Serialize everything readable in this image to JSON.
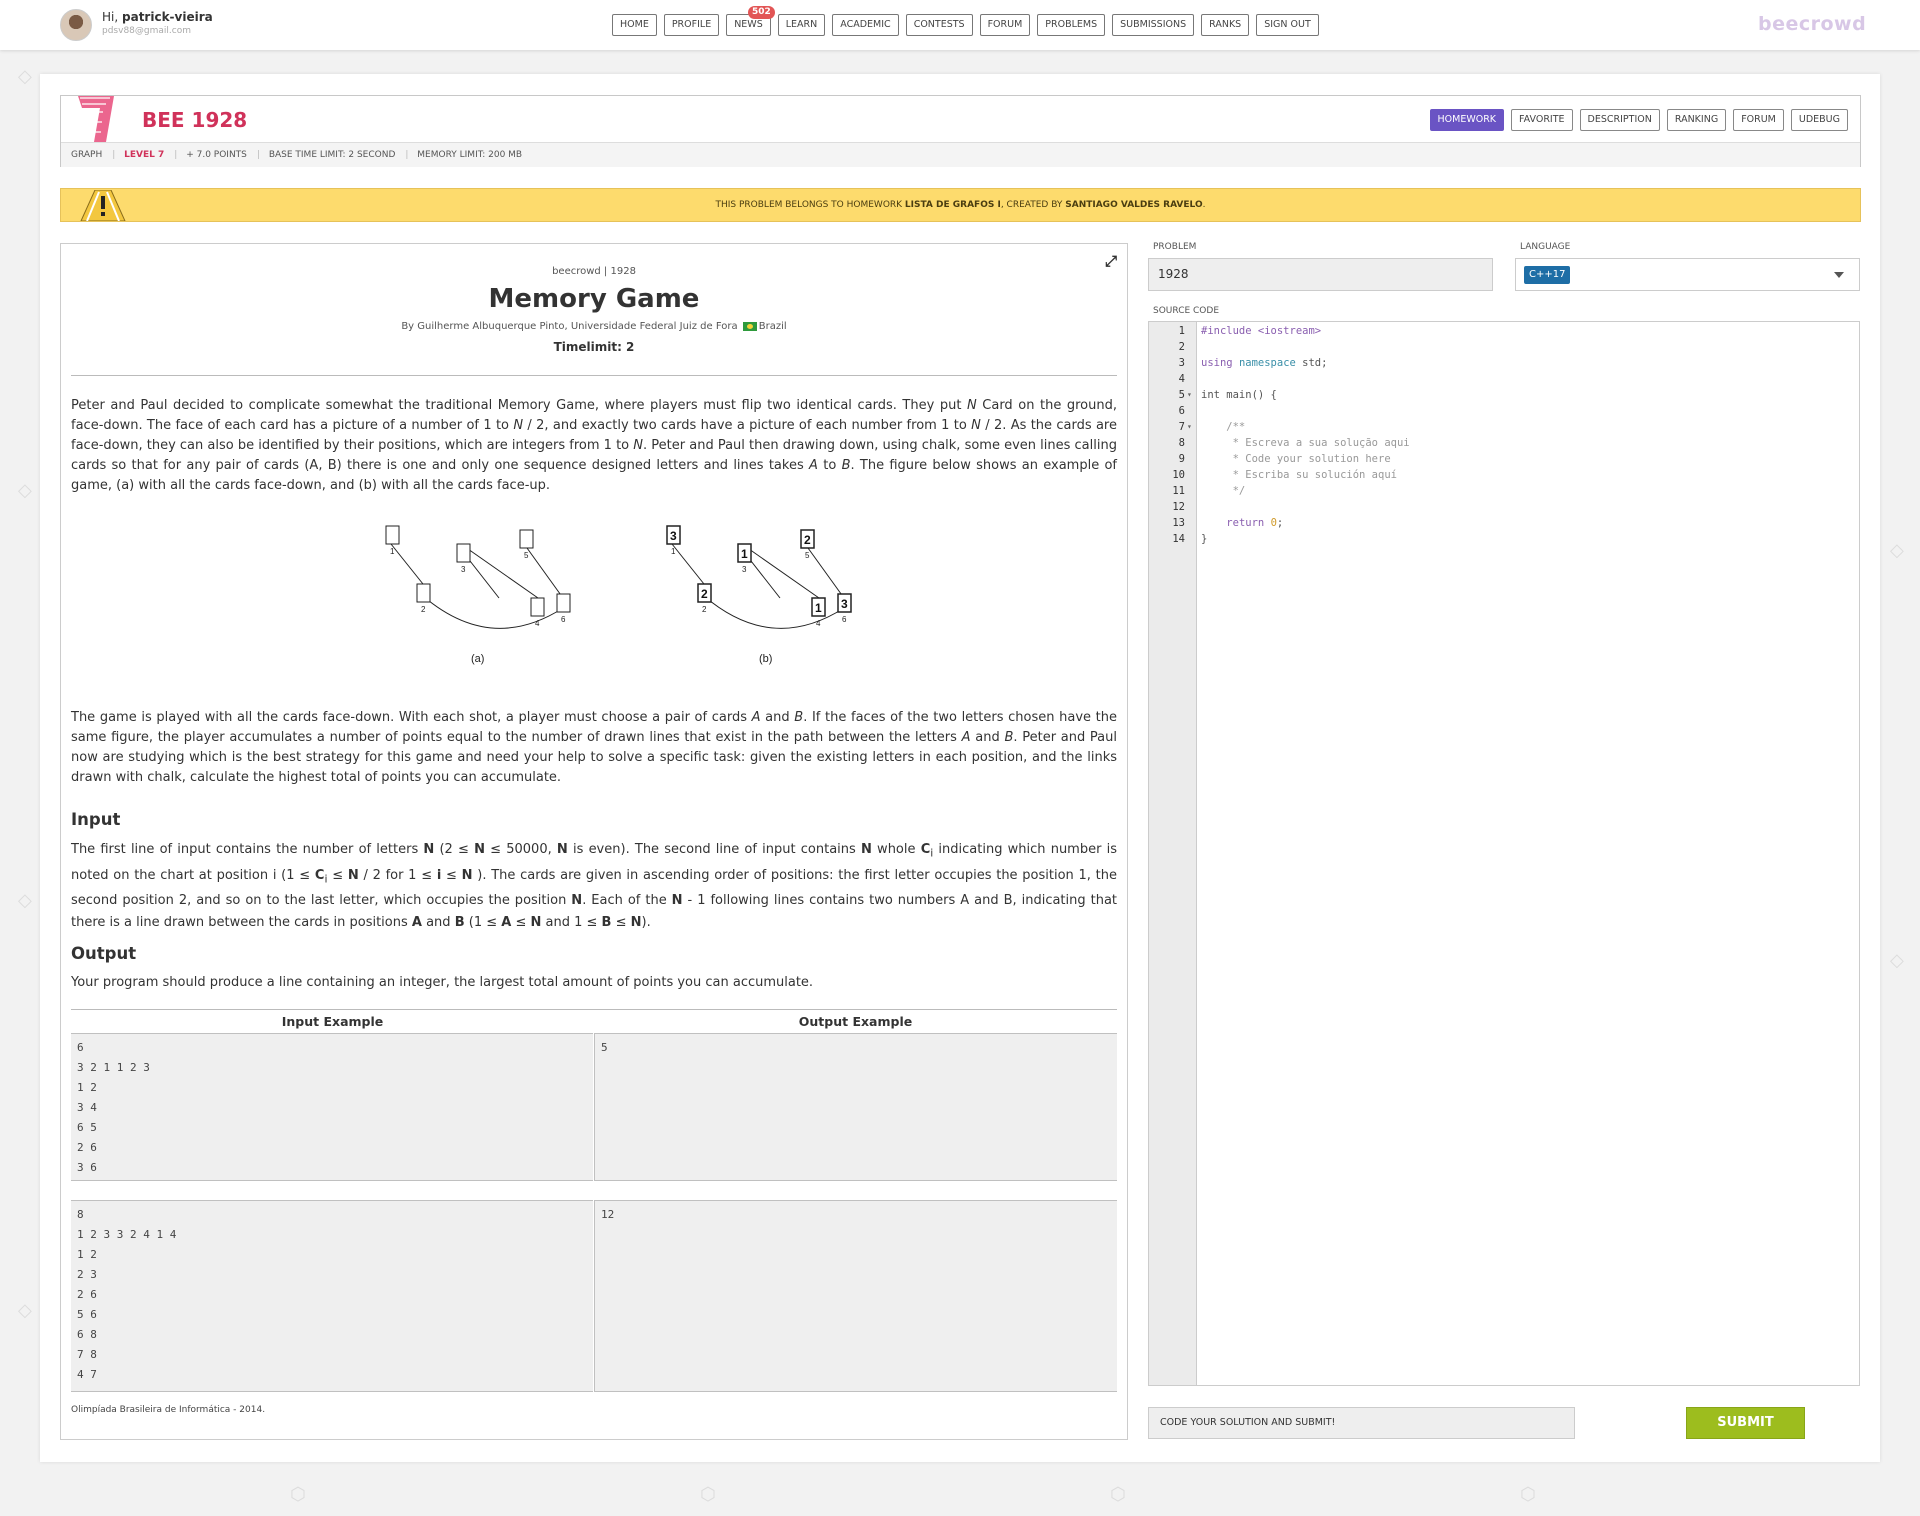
{
  "user": {
    "greeting_prefix": "Hi, ",
    "name": "patrick-vieira",
    "email": "pdsv88@gmail.com"
  },
  "nav": [
    {
      "label": "HOME"
    },
    {
      "label": "PROFILE"
    },
    {
      "label": "NEWS",
      "badge": "502"
    },
    {
      "label": "LEARN"
    },
    {
      "label": "ACADEMIC"
    },
    {
      "label": "CONTESTS"
    },
    {
      "label": "FORUM"
    },
    {
      "label": "PROBLEMS"
    },
    {
      "label": "SUBMISSIONS"
    },
    {
      "label": "RANKS"
    },
    {
      "label": "SIGN OUT"
    }
  ],
  "brand": "beecrowd",
  "problem_header": {
    "title": "BEE 1928",
    "meta": {
      "category": "GRAPH",
      "level": "LEVEL 7",
      "points": "+ 7.0 POINTS",
      "time_limit": "BASE TIME LIMIT: 2 SECOND",
      "memory_limit": "MEMORY LIMIT: 200 MB"
    },
    "tabs": [
      {
        "label": "HOMEWORK",
        "active": true
      },
      {
        "label": "FAVORITE",
        "active": false
      },
      {
        "label": "DESCRIPTION",
        "active": false
      },
      {
        "label": "RANKING",
        "active": false
      },
      {
        "label": "FORUM",
        "active": false
      },
      {
        "label": "UDEBUG",
        "active": false
      }
    ]
  },
  "homework_banner": {
    "prefix": "THIS PROBLEM BELONGS TO HOMEWORK ",
    "homework_name": "LISTA DE GRAFOS I",
    "middle": ", CREATED BY ",
    "creator": "SANTIAGO VALDES RAVELO",
    "suffix": "."
  },
  "problem": {
    "source": "beecrowd | 1928",
    "title": "Memory Game",
    "author_prefix": "By Guilherme Albuquerque Pinto, Universidade Federal Juiz de Fora",
    "author_country": "Brazil",
    "timelimit": "Timelimit: 2",
    "intro": {
      "p1a": "Peter and Paul decided to complicate somewhat the traditional Memory Game, where players must flip two identical cards. They put ",
      "N": "N",
      "p1b": " Card on the ground, face-down. The face of each card has a picture of a number of 1 to ",
      "Nhalf1": "N",
      "p1c": " / 2, and exactly two cards have a picture of each number from 1 to ",
      "Nhalf2": "N",
      "p1d": " / 2. As the cards are face-down, they can also be identified by their positions, which are integers from 1 to ",
      "Npos": "N",
      "p1e": ". Peter and Paul then drawing down, using chalk, some even lines calling cards so that for any pair of cards (A, B) there is one and only one sequence designed letters and lines takes ",
      "A": "A",
      "p1f": " to ",
      "B": "B",
      "p1g": ". The figure below shows an example of game, (a) with all the cards face-down, and (b) with all the cards face-up."
    },
    "figure": {
      "caption_a": "(a)",
      "caption_b": "(b)",
      "position_labels": [
        "1",
        "2",
        "3",
        "4",
        "5",
        "6"
      ],
      "face_values": [
        "3",
        "2",
        "1",
        "1",
        "2",
        "3"
      ]
    },
    "game": {
      "p2a": "The game is played with all the cards face-down. With each shot, a player must choose a pair of cards ",
      "A": "A",
      "p2b": " and ",
      "B": "B",
      "p2c": ". If the faces of the two letters chosen have the same figure, the player accumulates a number of points equal to the number of drawn lines that exist in the path between the letters ",
      "A2": "A",
      "p2d": " and ",
      "B2": "B",
      "p2e": ". Peter and Paul now are studying which is the best strategy for this game and need your help to solve a specific task: given the existing letters in each position, and the links drawn with chalk, calculate the highest total of points you can accumulate."
    },
    "input_heading": "Input",
    "input": {
      "a": "The first line of input contains the number of letters ",
      "N1": "N",
      "b": " (2 ≤ ",
      "N2": "N",
      "c": " ≤ 50000, ",
      "N3": "N",
      "d": " is even). The second line of input contains ",
      "N4": "N",
      "e": " whole ",
      "Ci": "C",
      "sub_i": "i",
      "f": " indicating which number is noted on the chart at position i (1 ≤ ",
      "Ci2": "C",
      "sub_i2": "i",
      "g": " ≤ ",
      "N5": "N",
      "h": " / 2 for 1 ≤ ",
      "i_bold": "i",
      "j": " ≤ ",
      "N6": "N",
      "k": " ). The cards are given in ascending order of positions: the first letter occupies the position 1, the second position 2, and so on to the last letter, which occupies the position ",
      "N7": "N",
      "l": ". Each of the ",
      "N8": "N",
      "m": " - 1 following lines contains two numbers A and B, indicating that there is a line drawn between the cards in positions ",
      "A": "A",
      "n": " and ",
      "B": "B",
      "o": " (1 ≤ ",
      "A2": "A",
      "p": " ≤ ",
      "N9": "N",
      "q": " and 1 ≤ ",
      "B2": "B",
      "r": " ≤ ",
      "N10": "N",
      "s": ")."
    },
    "output_heading": "Output",
    "output_text": "Your program should produce a line containing an integer, the largest total amount of points you can accumulate.",
    "examples_header": {
      "input": "Input Example",
      "output": "Output Example"
    },
    "examples": [
      {
        "input": "6\n3 2 1 1 2 3\n1 2\n3 4\n6 5\n2 6\n3 6",
        "output": "5"
      },
      {
        "input": "8\n1 2 3 3 2 4 1 4\n1 2\n2 3\n2 6\n5 6\n6 8\n7 8\n4 7",
        "output": "12"
      }
    ],
    "credit": "Olimpíada Brasileira de Informática - 2014."
  },
  "editor": {
    "problem_label": "PROBLEM",
    "problem_value": "1928",
    "language_label": "LANGUAGE",
    "language_value": "C++17",
    "source_label": "SOURCE CODE",
    "code_lines": [
      "#include <iostream>",
      "",
      "using namespace std;",
      "",
      "int main() {",
      "",
      "    /**",
      "     * Escreva a sua solução aqui",
      "     * Code your solution here",
      "     * Escriba su solución aquí",
      "     */",
      "",
      "    return 0;",
      "}"
    ],
    "message": "CODE YOUR SOLUTION AND SUBMIT!",
    "submit_label": "SUBMIT"
  },
  "colors": {
    "accent": "#6a54c4",
    "title_red": "#d0325a",
    "banner": "#fddb6d",
    "submit": "#9dbd1e",
    "lang_chip": "#1e6ea6"
  }
}
